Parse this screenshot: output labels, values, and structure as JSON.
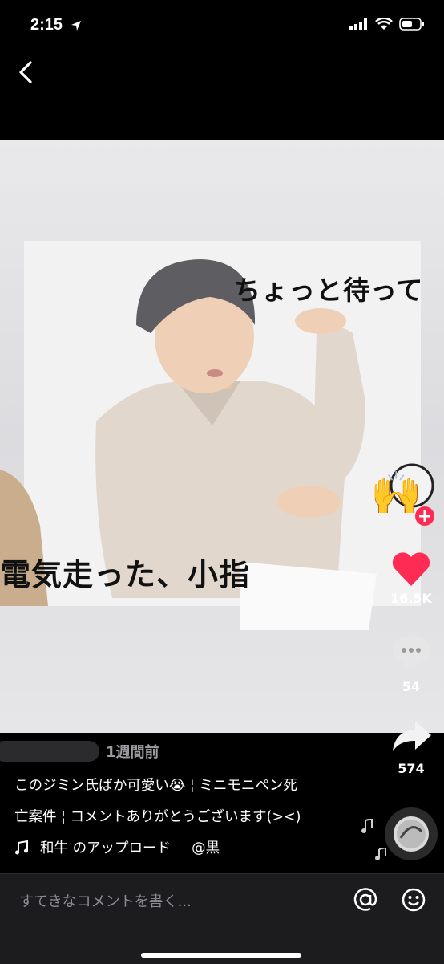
{
  "status_bar": {
    "time": "2:15"
  },
  "video": {
    "caption_top": "ちょっと待って",
    "caption_bottom": "電気走った、小指"
  },
  "actions": {
    "likes": "16.5K",
    "comments": "54",
    "shares": "574"
  },
  "post": {
    "posted": "1週間前",
    "caption_line1": "このジミン氏ばか可愛い😭 ¦ ミニモニペン死",
    "caption_line2": "亡案件 ¦ コメントありがとうございます(><)",
    "music": "和牛 のアップロード",
    "music_handle": "@黒"
  },
  "comment_bar": {
    "placeholder": "すてきなコメントを書く..."
  },
  "colors": {
    "like": "#fe2c55",
    "background": "#000000",
    "bar": "#1c1c1e"
  }
}
